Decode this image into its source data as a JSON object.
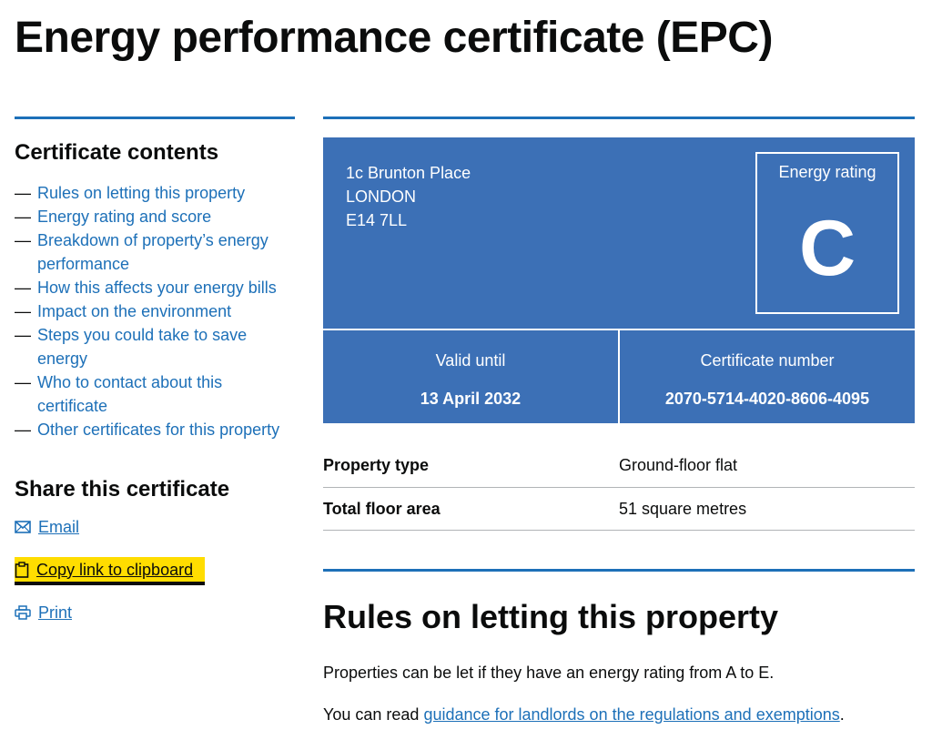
{
  "page": {
    "title": "Energy performance certificate (EPC)"
  },
  "sidebar": {
    "contents_heading": "Certificate contents",
    "contents": [
      {
        "label": "Rules on letting this property"
      },
      {
        "label": "Energy rating and score"
      },
      {
        "label": "Breakdown of property’s energy performance"
      },
      {
        "label": "How this affects your energy bills"
      },
      {
        "label": "Impact on the environment"
      },
      {
        "label": "Steps you could take to save energy"
      },
      {
        "label": "Who to contact about this certificate"
      },
      {
        "label": "Other certificates for this property"
      }
    ],
    "share_heading": "Share this certificate",
    "share": [
      {
        "label": "Email",
        "icon": "envelope-icon"
      },
      {
        "label": "Copy link to clipboard",
        "icon": "clipboard-icon"
      },
      {
        "label": "Print",
        "icon": "printer-icon"
      }
    ]
  },
  "epc": {
    "address": [
      "1c Brunton Place",
      "LONDON",
      "E14 7LL"
    ],
    "rating_label": "Energy rating",
    "rating": "C",
    "valid_label": "Valid until",
    "valid_value": "13 April 2032",
    "cert_label": "Certificate number",
    "cert_value": "2070-5714-4020-8606-4095",
    "card_color": "#3c70b6"
  },
  "summary": [
    {
      "key": "Property type",
      "value": "Ground-floor flat"
    },
    {
      "key": "Total floor area",
      "value": "51 square metres"
    }
  ],
  "letting": {
    "title": "Rules on letting this property",
    "para1": "Properties can be let if they have an energy rating from A to E.",
    "para2_prefix": "You can read ",
    "para2_link": "guidance for landlords on the regulations and exemptions",
    "para2_suffix": "."
  },
  "colors": {
    "link": "#1d70b8",
    "focus": "#ffdd00",
    "text": "#0b0c0c"
  }
}
